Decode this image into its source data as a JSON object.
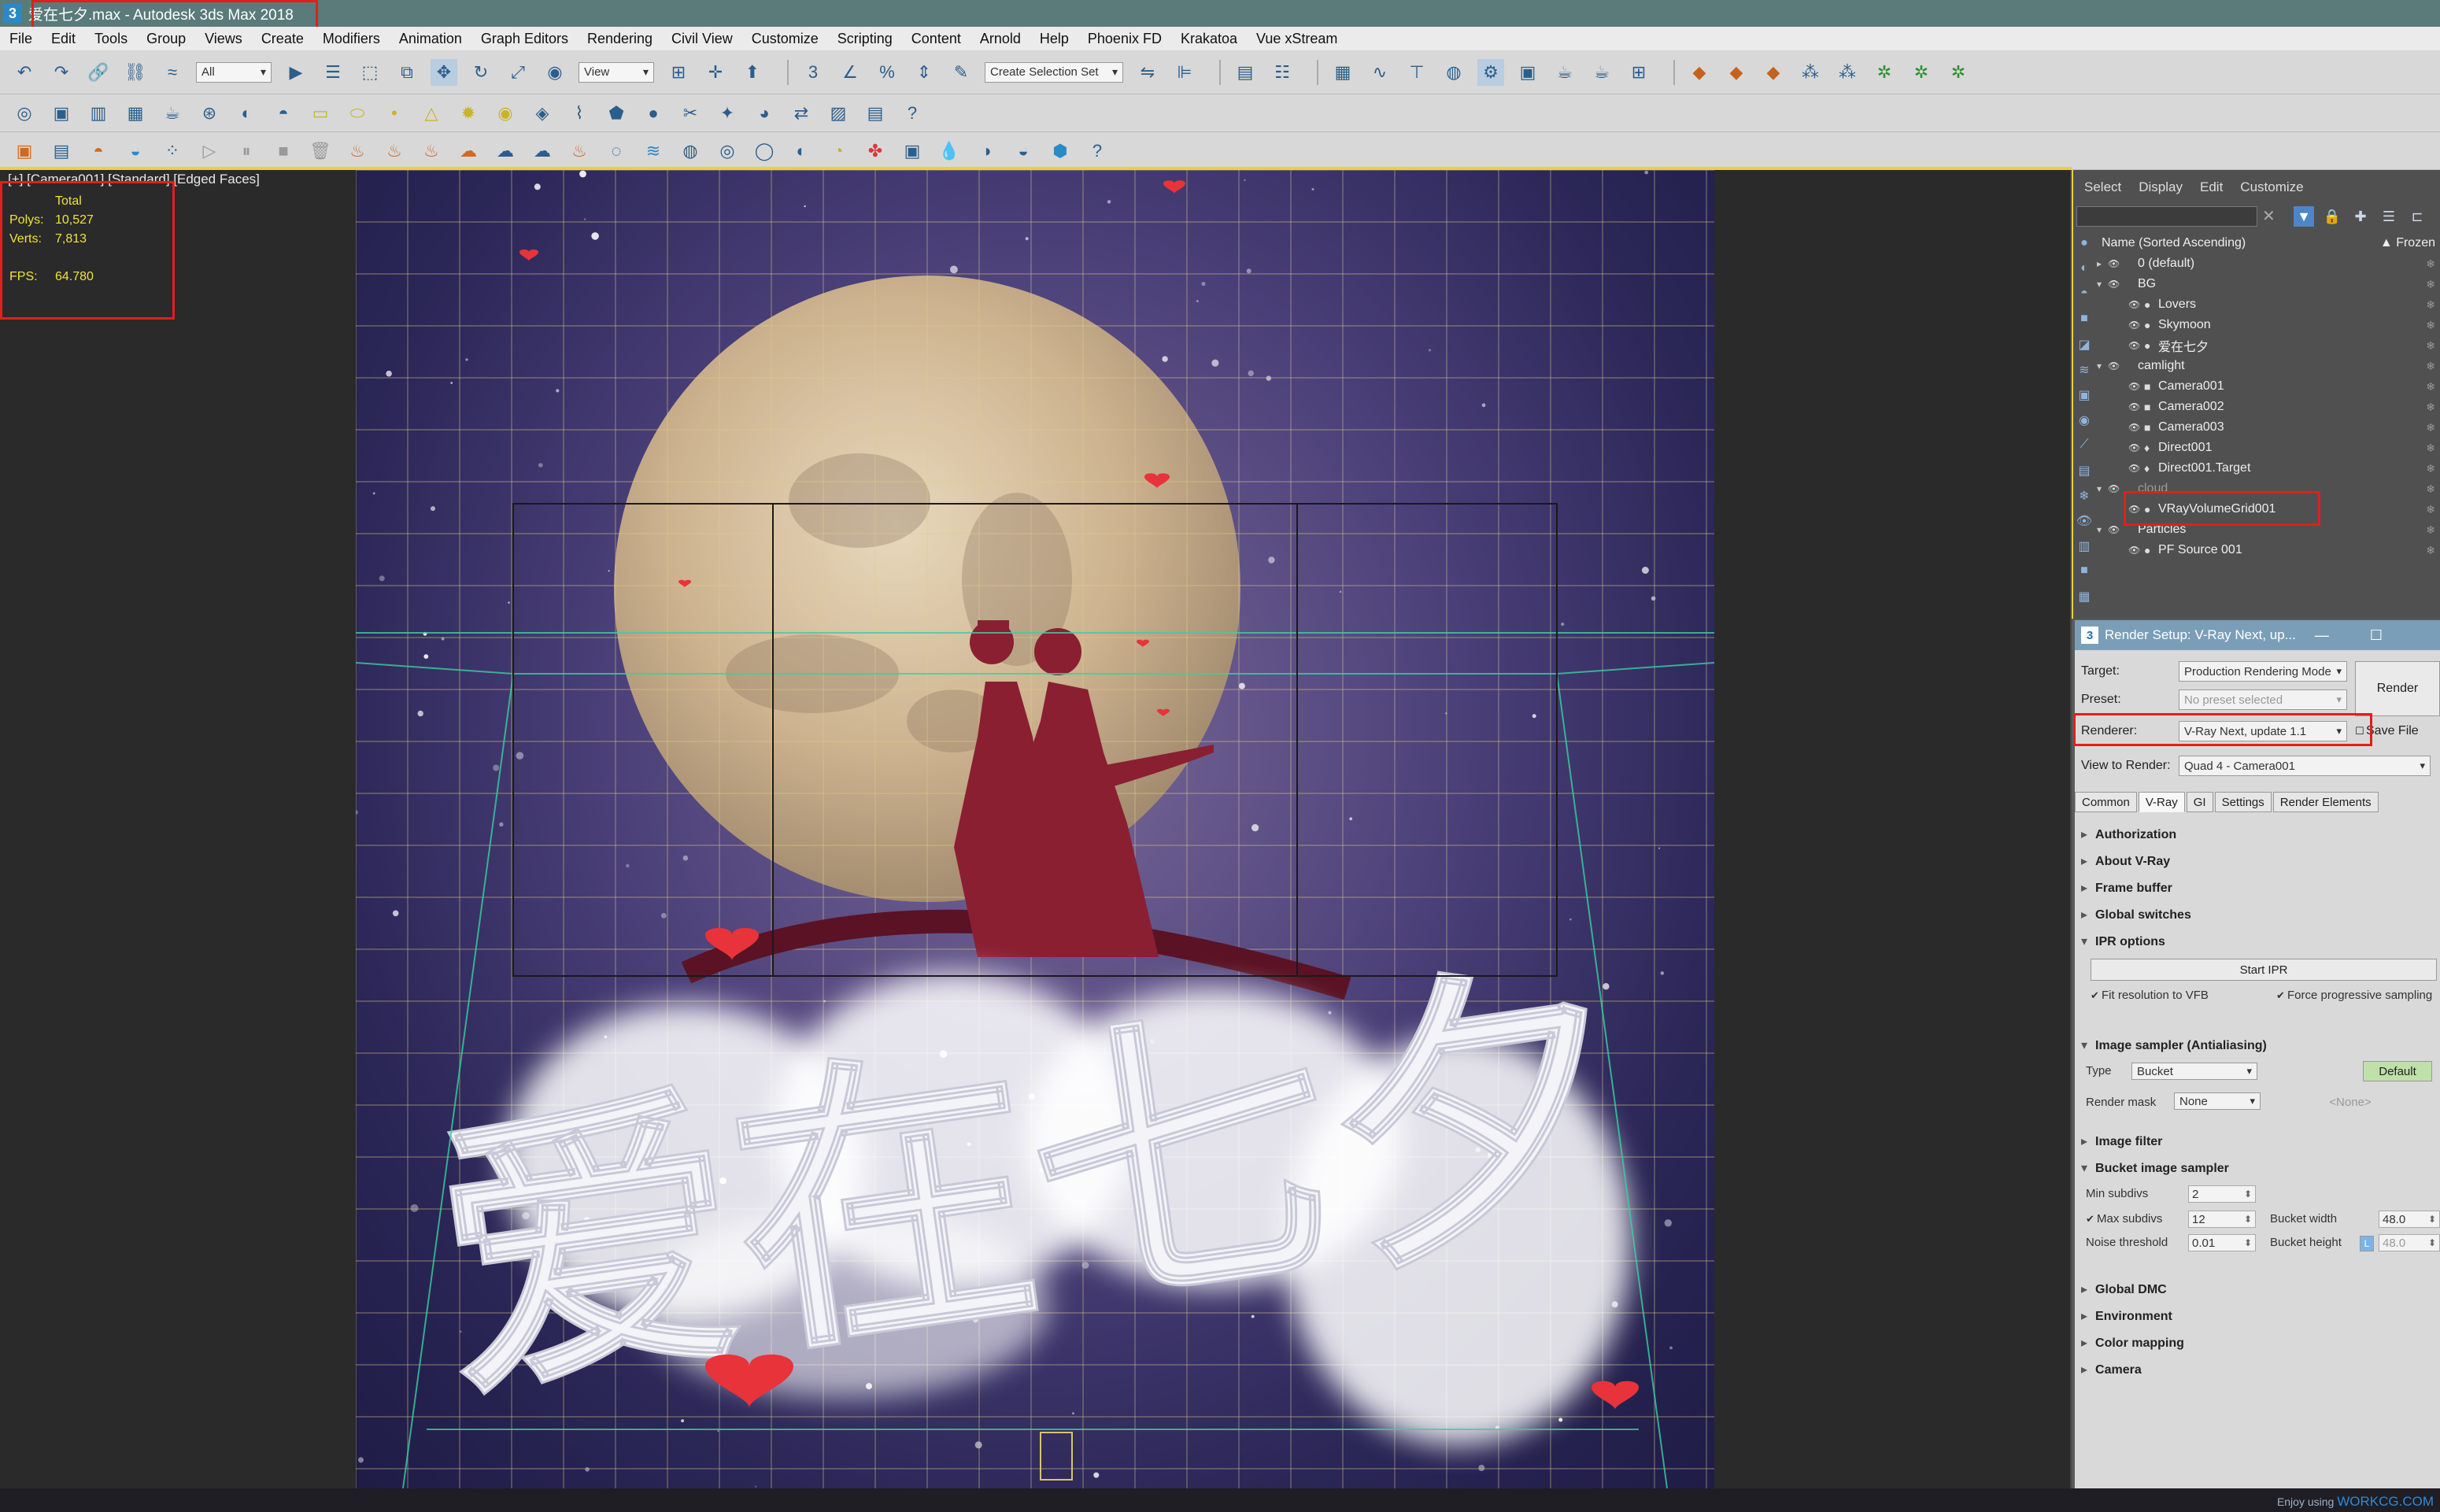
{
  "window": {
    "title": "爱在七夕.max - Autodesk 3ds Max 2018",
    "icon": "3"
  },
  "menu": [
    "File",
    "Edit",
    "Tools",
    "Group",
    "Views",
    "Create",
    "Modifiers",
    "Animation",
    "Graph Editors",
    "Rendering",
    "Civil View",
    "Customize",
    "Scripting",
    "Content",
    "Arnold",
    "Help",
    "Phoenix FD",
    "Krakatoa",
    "Vue xStream"
  ],
  "toolbar": {
    "selection_filter": "All",
    "ref_coord": "View",
    "selection_set_placeholder": "Create Selection Set"
  },
  "viewport": {
    "label": "[+] [Camera001] [Standard] [Edged Faces]",
    "stats": {
      "header": "Total",
      "rows": [
        {
          "key": "Polys:",
          "value": "10,527"
        },
        {
          "key": "Verts:",
          "value": "7,813"
        },
        {
          "key": "FPS:",
          "value": "64.780"
        }
      ]
    },
    "scene_text": "爱在七夕",
    "colors": {
      "sky": "#2a2656",
      "moon": "#d8c6a8",
      "silhouette": "#8a1f32",
      "heart": "#e8333a",
      "grid": "#d9c890"
    }
  },
  "scene_explorer": {
    "tabs": [
      "Select",
      "Display",
      "Edit",
      "Customize"
    ],
    "column_header": "Name (Sorted Ascending)",
    "frozen_header": "▲ Frozen",
    "rows": [
      {
        "label": "0 (default)",
        "level": 0,
        "arrow": "▸",
        "bullet": ""
      },
      {
        "label": "BG",
        "level": 0,
        "arrow": "▾",
        "bullet": ""
      },
      {
        "label": "Lovers",
        "level": 1,
        "arrow": "",
        "bullet": "●"
      },
      {
        "label": "Skymoon",
        "level": 1,
        "arrow": "",
        "bullet": "●"
      },
      {
        "label": "爱在七夕",
        "level": 1,
        "arrow": "",
        "bullet": "●"
      },
      {
        "label": "camlight",
        "level": 0,
        "arrow": "▾",
        "bullet": ""
      },
      {
        "label": "Camera001",
        "level": 1,
        "arrow": "",
        "bullet": "■"
      },
      {
        "label": "Camera002",
        "level": 1,
        "arrow": "",
        "bullet": "■"
      },
      {
        "label": "Camera003",
        "level": 1,
        "arrow": "",
        "bullet": "■"
      },
      {
        "label": "Direct001",
        "level": 1,
        "arrow": "",
        "bullet": "♦"
      },
      {
        "label": "Direct001.Target",
        "level": 1,
        "arrow": "",
        "bullet": "♦"
      },
      {
        "label": "cloud",
        "level": 0,
        "arrow": "▾",
        "bullet": ""
      },
      {
        "label": "VRayVolumeGrid001",
        "level": 1,
        "arrow": "",
        "bullet": "●"
      },
      {
        "label": "Particles",
        "level": 0,
        "arrow": "▾",
        "bullet": ""
      },
      {
        "label": "PF Source 001",
        "level": 1,
        "arrow": "",
        "bullet": "●"
      }
    ]
  },
  "render_setup": {
    "title": "Render Setup: V-Ray Next, up...",
    "target_label": "Target:",
    "target_value": "Production Rendering Mode",
    "preset_label": "Preset:",
    "preset_value": "No preset selected",
    "renderer_label": "Renderer:",
    "renderer_value": "V-Ray Next, update 1.1",
    "save_file_label": "Save File",
    "render_button": "Render",
    "view_label": "View to Render:",
    "view_value": "Quad 4 - Camera001",
    "tabs": [
      "Common",
      "V-Ray",
      "GI",
      "Settings",
      "Render Elements"
    ],
    "rollouts_top": [
      "Authorization",
      "About V-Ray",
      "Frame buffer",
      "Global switches"
    ],
    "ipr": {
      "title": "IPR options",
      "start_button": "Start IPR",
      "fit_label": "Fit resolution to VFB",
      "force_label": "Force progressive sampling"
    },
    "image_sampler": {
      "title": "Image sampler (Antialiasing)",
      "type_label": "Type",
      "type_value": "Bucket",
      "default_button": "Default",
      "mask_label": "Render mask",
      "mask_value": "None",
      "mask_object": "<None>"
    },
    "image_filter": "Image filter",
    "bucket": {
      "title": "Bucket image sampler",
      "min_label": "Min subdivs",
      "min_value": "2",
      "max_label": "Max subdivs",
      "max_value": "12",
      "noise_label": "Noise threshold",
      "noise_value": "0.01",
      "width_label": "Bucket width",
      "width_value": "48.0",
      "height_label": "Bucket height",
      "height_value": "48.0",
      "lock": "L"
    },
    "rollouts_bottom": [
      "Global DMC",
      "Environment",
      "Color mapping",
      "Camera"
    ]
  },
  "watermark": {
    "prefix": "Enjoy using",
    "brand": "WORKCG.COM"
  }
}
